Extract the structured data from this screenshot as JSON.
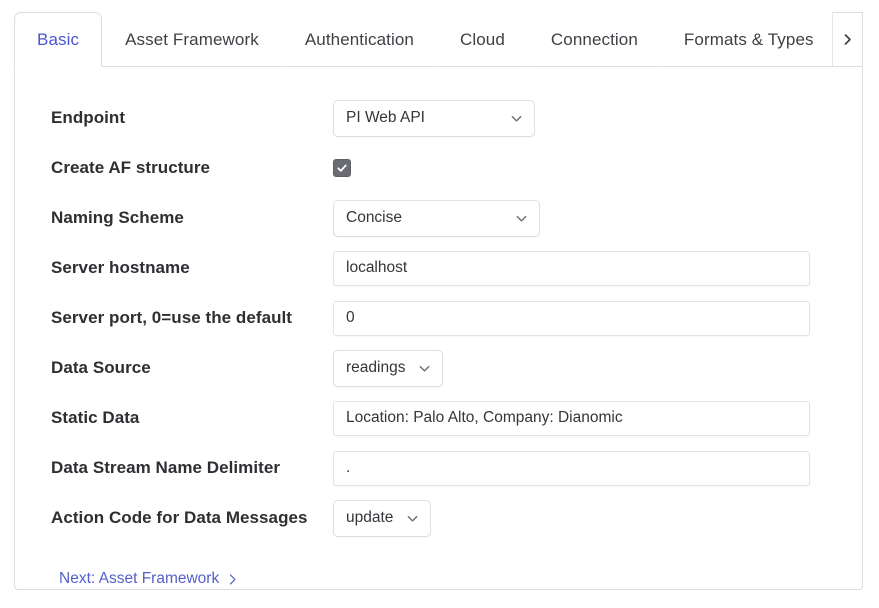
{
  "tabs": {
    "items": [
      {
        "label": "Basic",
        "active": true
      },
      {
        "label": "Asset Framework",
        "active": false
      },
      {
        "label": "Authentication",
        "active": false
      },
      {
        "label": "Cloud",
        "active": false
      },
      {
        "label": "Connection",
        "active": false
      },
      {
        "label": "Formats & Types",
        "active": false
      }
    ],
    "scroll_right_icon": "chevron-right-icon",
    "active_color": "#4b56d2",
    "inactive_color": "#3f3f46"
  },
  "form": {
    "rows": [
      {
        "label": "Endpoint",
        "control": "select",
        "value": "PI Web API",
        "icon": "chevron-down-icon"
      },
      {
        "label": "Create AF structure",
        "control": "checkbox",
        "checked": true,
        "icon": "check-icon"
      },
      {
        "label": "Naming Scheme",
        "control": "select",
        "value": "Concise",
        "icon": "chevron-down-icon"
      },
      {
        "label": "Server hostname",
        "control": "text",
        "value": "localhost",
        "placeholder": ""
      },
      {
        "label": "Server port, 0=use the default",
        "control": "text",
        "value": "0",
        "placeholder": ""
      },
      {
        "label": "Data Source",
        "control": "select",
        "value": "readings",
        "icon": "chevron-down-icon"
      },
      {
        "label": "Static Data",
        "control": "text",
        "value": "Location: Palo Alto, Company: Dianomic",
        "placeholder": ""
      },
      {
        "label": "Data Stream Name Delimiter",
        "control": "text",
        "value": ".",
        "placeholder": ""
      },
      {
        "label": "Action Code for Data Messages",
        "control": "select",
        "value": "update",
        "icon": "chevron-down-icon"
      }
    ]
  },
  "footer": {
    "next_label": "Next: Asset Framework",
    "next_icon": "chevron-right-icon",
    "link_color": "#5560c9"
  }
}
